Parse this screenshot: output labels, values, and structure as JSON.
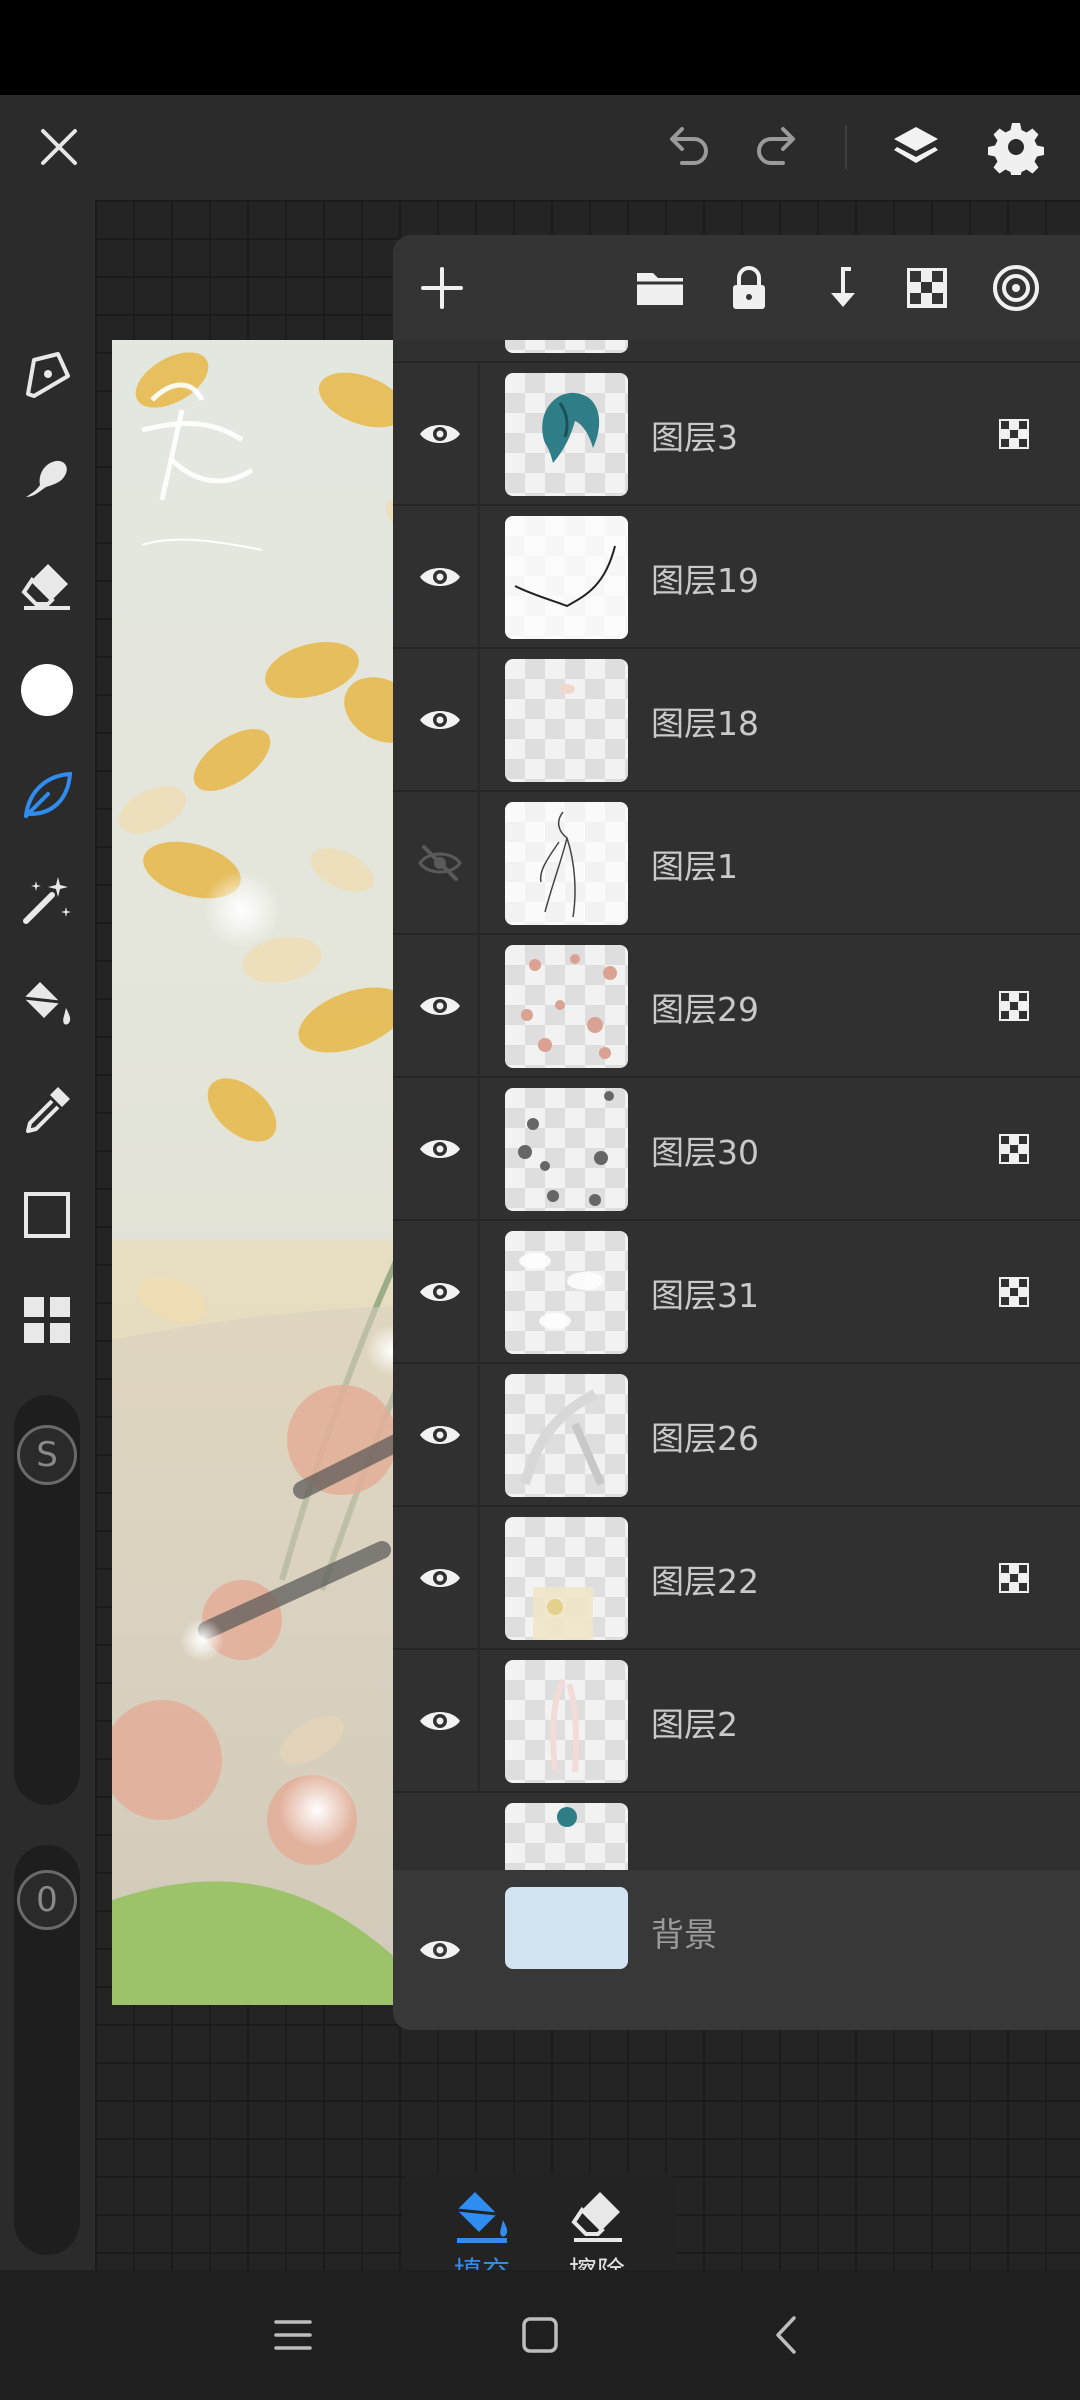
{
  "toolbar": {
    "close_icon": "close-icon",
    "undo_icon": "undo-icon",
    "redo_icon": "redo-icon",
    "layers_icon": "layers-icon",
    "settings_icon": "settings-icon"
  },
  "tools": [
    {
      "name": "pen-tool",
      "icon": "pen-nib-icon"
    },
    {
      "name": "smudge-tool",
      "icon": "smudge-icon"
    },
    {
      "name": "eraser-tool",
      "icon": "eraser-icon"
    },
    {
      "name": "color-picker",
      "icon": "color-swatch-icon",
      "color": "#ffffff"
    },
    {
      "name": "selection-lasso-tool",
      "icon": "leaf-lasso-icon",
      "active": true
    },
    {
      "name": "magic-wand-tool",
      "icon": "magic-wand-icon"
    },
    {
      "name": "fill-tool",
      "icon": "paint-bucket-icon"
    },
    {
      "name": "eyedropper-tool",
      "icon": "eyedropper-icon"
    },
    {
      "name": "shape-tool",
      "icon": "square-icon"
    },
    {
      "name": "panels-tool",
      "icon": "grid-icon"
    }
  ],
  "sliders": {
    "size_label": "S",
    "opacity_label": "0"
  },
  "layer_panel": {
    "toolbar_icons": [
      "add-icon",
      "folder-icon",
      "lock-icon",
      "merge-down-icon",
      "alpha-icon",
      "target-icon"
    ],
    "layers": [
      {
        "name": "图层3",
        "visible": true,
        "alpha_locked": true
      },
      {
        "name": "图层19",
        "visible": true,
        "alpha_locked": false
      },
      {
        "name": "图层18",
        "visible": true,
        "alpha_locked": false
      },
      {
        "name": "图层1",
        "visible": false,
        "alpha_locked": false
      },
      {
        "name": "图层29",
        "visible": true,
        "alpha_locked": true
      },
      {
        "name": "图层30",
        "visible": true,
        "alpha_locked": true
      },
      {
        "name": "图层31",
        "visible": true,
        "alpha_locked": true
      },
      {
        "name": "图层26",
        "visible": true,
        "alpha_locked": false
      },
      {
        "name": "图层22",
        "visible": true,
        "alpha_locked": true
      },
      {
        "name": "图层2",
        "visible": true,
        "alpha_locked": false
      }
    ],
    "background": {
      "name": "背景",
      "color": "#d4e3f2",
      "visible": true
    }
  },
  "fill_popup": {
    "fill_label": "填充",
    "erase_label": "擦除",
    "active_color": "#2f8cf0"
  },
  "colors": {
    "accent": "#2f8cf0",
    "panel": "#303030",
    "background": "#2b2b2b"
  }
}
